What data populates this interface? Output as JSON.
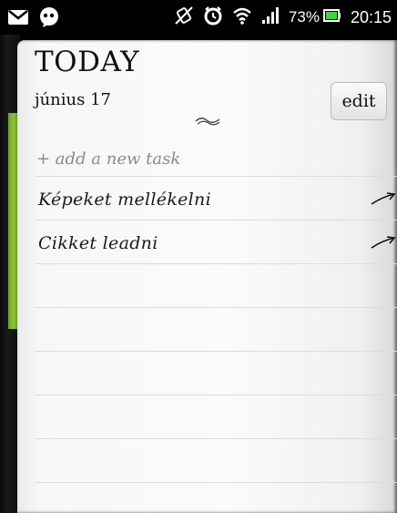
{
  "status_bar": {
    "battery": "73%",
    "time": "20:15",
    "icons": [
      "gmail-icon",
      "chat-icon",
      "mute-vibrate-icon",
      "alarm-icon",
      "wifi-icon",
      "signal-icon",
      "battery-icon"
    ]
  },
  "header": {
    "title": "TODAY",
    "date": "június 17",
    "edit_label": "edit"
  },
  "add_task_placeholder": "+ add a new task",
  "tasks": [
    {
      "label": "Képeket mellékelni"
    },
    {
      "label": "Cikket leadni"
    }
  ],
  "colors": {
    "accent_tab": "#8ec438",
    "paper": "#f7f7f7",
    "ink": "#1a1a1a"
  }
}
